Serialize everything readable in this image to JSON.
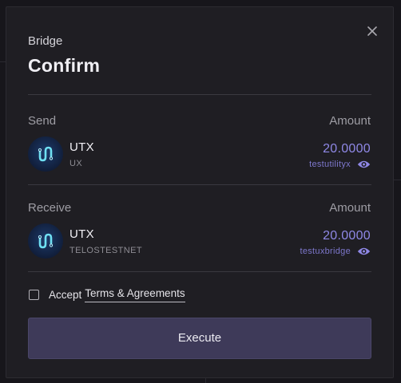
{
  "modal": {
    "kicker": "Bridge",
    "title": "Confirm",
    "close_icon": "close-icon"
  },
  "send": {
    "label": "Send",
    "amount_label": "Amount",
    "token_symbol": "UTX",
    "token_chain": "UX",
    "amount": "20.0000",
    "account": "testutilityx",
    "account_icon": "eye-icon"
  },
  "receive": {
    "label": "Receive",
    "amount_label": "Amount",
    "token_symbol": "UTX",
    "token_chain": "TELOSTESTNET",
    "amount": "20.0000",
    "account": "testuxbridge",
    "account_icon": "eye-icon"
  },
  "terms": {
    "checked": false,
    "prefix": "Accept",
    "link": "Terms & Agreements"
  },
  "actions": {
    "execute_label": "Execute"
  },
  "colors": {
    "accent": "#8f88e6",
    "button_bg": "#3e3a59",
    "modal_bg": "#1f1e23"
  }
}
